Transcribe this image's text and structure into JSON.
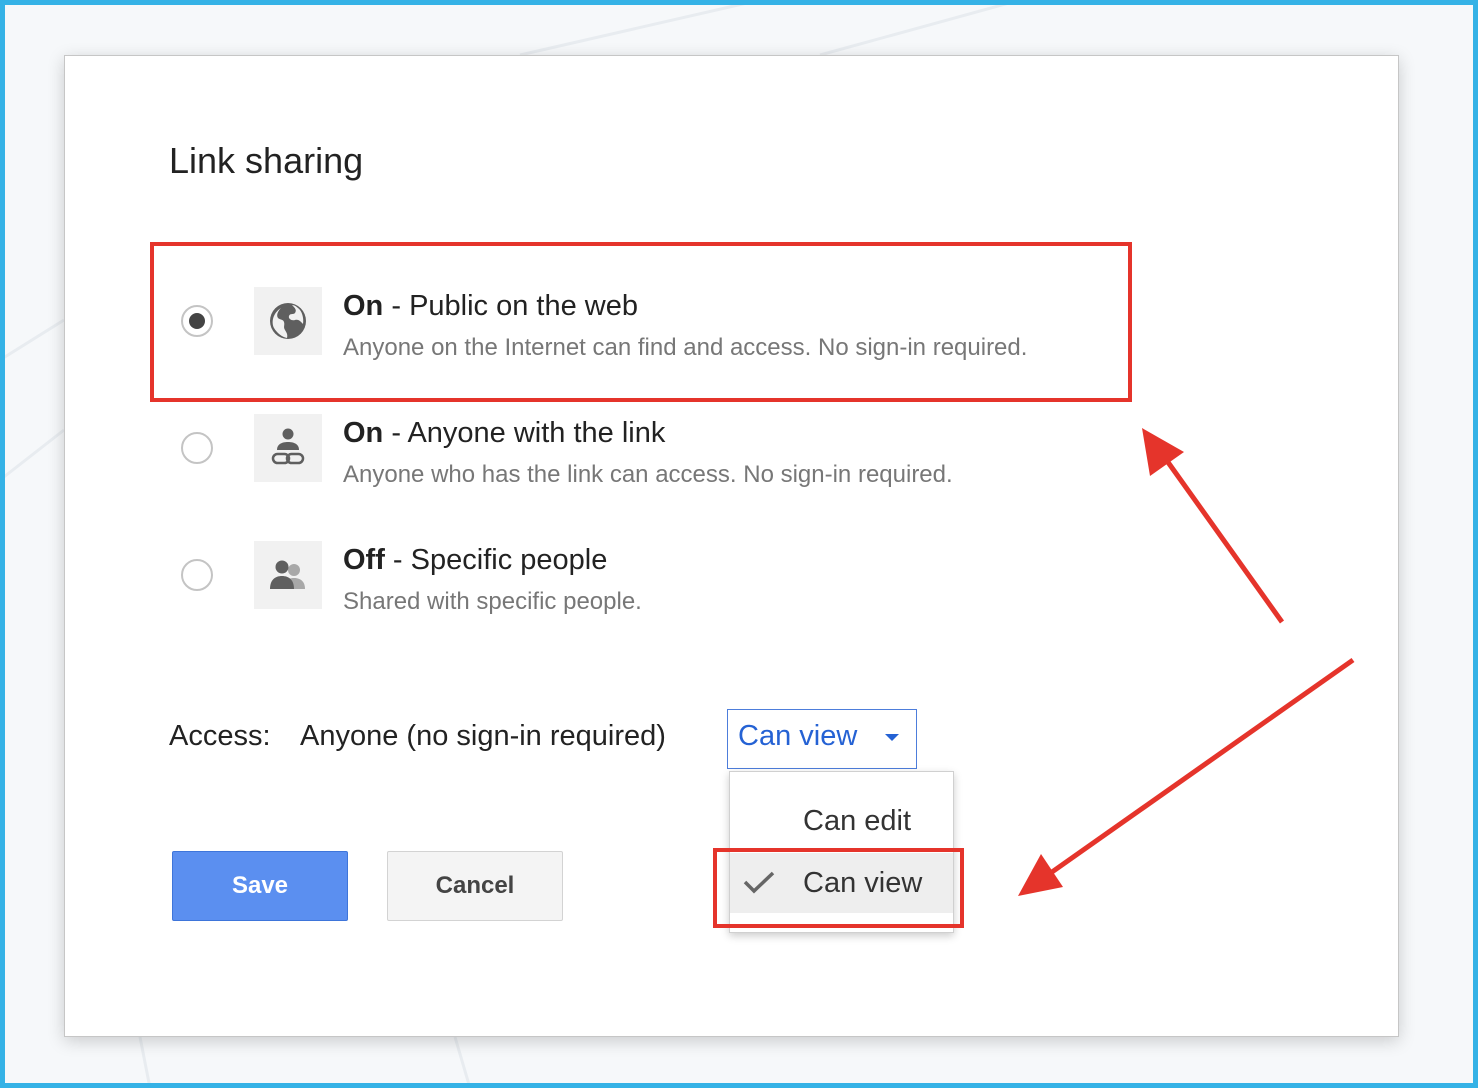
{
  "dialog": {
    "title": "Link sharing"
  },
  "options": [
    {
      "state": "On",
      "separator": " - ",
      "title": "Public on the web",
      "description": "Anyone on the Internet can find and access. No sign-in required.",
      "icon": "globe-icon",
      "selected": true
    },
    {
      "state": "On",
      "separator": " - ",
      "title": "Anyone with the link",
      "description": "Anyone who has the link can access. No sign-in required.",
      "icon": "person-link-icon",
      "selected": false
    },
    {
      "state": "Off",
      "separator": " - ",
      "title": "Specific people",
      "description": "Shared with specific people.",
      "icon": "people-icon",
      "selected": false
    }
  ],
  "access": {
    "label": "Access:",
    "value": "Anyone (no sign-in required)",
    "dropdown_value": "Can view",
    "menu": [
      {
        "label": "Can edit",
        "selected": false
      },
      {
        "label": "Can view",
        "selected": true
      }
    ]
  },
  "buttons": {
    "save": "Save",
    "cancel": "Cancel"
  },
  "colors": {
    "annotation": "#e5342b",
    "link_blue": "#2562d4",
    "primary_button": "#5b8ff0",
    "frame": "#35b2e6"
  }
}
